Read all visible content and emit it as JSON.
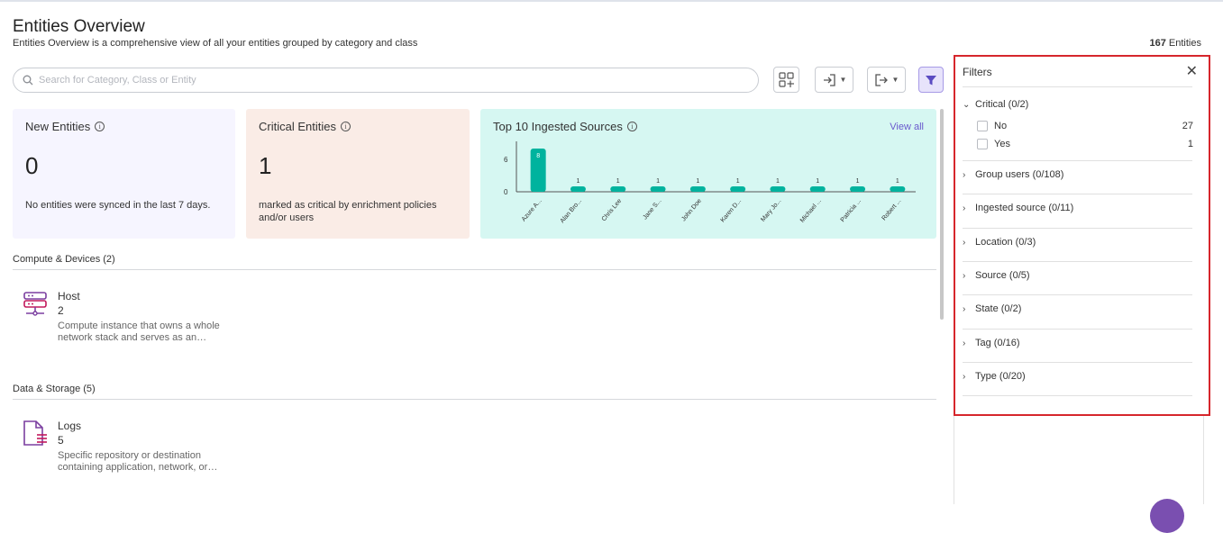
{
  "header": {
    "title": "Entities Overview",
    "subtitle": "Entities Overview is a comprehensive view of all your entities grouped by category and class",
    "total_count": "167",
    "total_label": "Entities"
  },
  "search": {
    "placeholder": "Search for Category, Class or Entity",
    "value": ""
  },
  "toolbar": {
    "grid_icon": "add-grid-icon",
    "import_icon": "import-icon",
    "export_icon": "export-icon",
    "filter_icon": "filter-icon",
    "filter_active_color": "#e7e3fb"
  },
  "cards": {
    "new": {
      "title": "New Entities",
      "value": "0",
      "desc": "No entities were synced in the last 7 days.",
      "bg": "#f6f5ff"
    },
    "critical": {
      "title": "Critical Entities",
      "value": "1",
      "desc": "marked as critical by enrichment policies and/or users",
      "bg": "#faece6"
    },
    "top": {
      "title": "Top 10 Ingested Sources",
      "view_all": "View all",
      "bg": "#d6f7f2"
    }
  },
  "chart_data": {
    "type": "bar",
    "categories": [
      "Azure A...",
      "Alan Bro...",
      "Chris Lee",
      "Jane S...",
      "John Doe",
      "Karen D...",
      "Mary Jo...",
      "Michael ...",
      "Patricia ...",
      "Robert ..."
    ],
    "values": [
      8,
      1,
      1,
      1,
      1,
      1,
      1,
      1,
      1,
      1
    ],
    "data_labels": [
      "8",
      "1",
      "1",
      "1",
      "1",
      "1",
      "1",
      "1",
      "1",
      "1"
    ],
    "yticks": [
      "6",
      "0"
    ],
    "ylim": [
      0,
      8
    ],
    "bar_color": "#00b39e",
    "grid": false
  },
  "sections": [
    {
      "title": "Compute & Devices (2)",
      "entities": [
        {
          "name": "Host",
          "count": "2",
          "desc": "Compute instance that owns a whole network stack and serves as an…",
          "icon": "host-server-icon"
        }
      ]
    },
    {
      "title": "Data & Storage (5)",
      "entities": [
        {
          "name": "Logs",
          "count": "5",
          "desc": "Specific repository or destination containing application, network, or…",
          "icon": "logs-file-icon"
        }
      ]
    }
  ],
  "filters": {
    "title": "Filters",
    "groups": [
      {
        "label": "Critical (0/2)",
        "expanded": true,
        "options": [
          {
            "label": "No",
            "count": "27"
          },
          {
            "label": "Yes",
            "count": "1"
          }
        ]
      },
      {
        "label": "Group users (0/108)",
        "expanded": false
      },
      {
        "label": "Ingested source (0/11)",
        "expanded": false
      },
      {
        "label": "Location (0/3)",
        "expanded": false
      },
      {
        "label": "Source (0/5)",
        "expanded": false
      },
      {
        "label": "State (0/2)",
        "expanded": false
      },
      {
        "label": "Tag (0/16)",
        "expanded": false
      },
      {
        "label": "Type (0/20)",
        "expanded": false
      }
    ],
    "highlight_color": "#d6262c"
  }
}
